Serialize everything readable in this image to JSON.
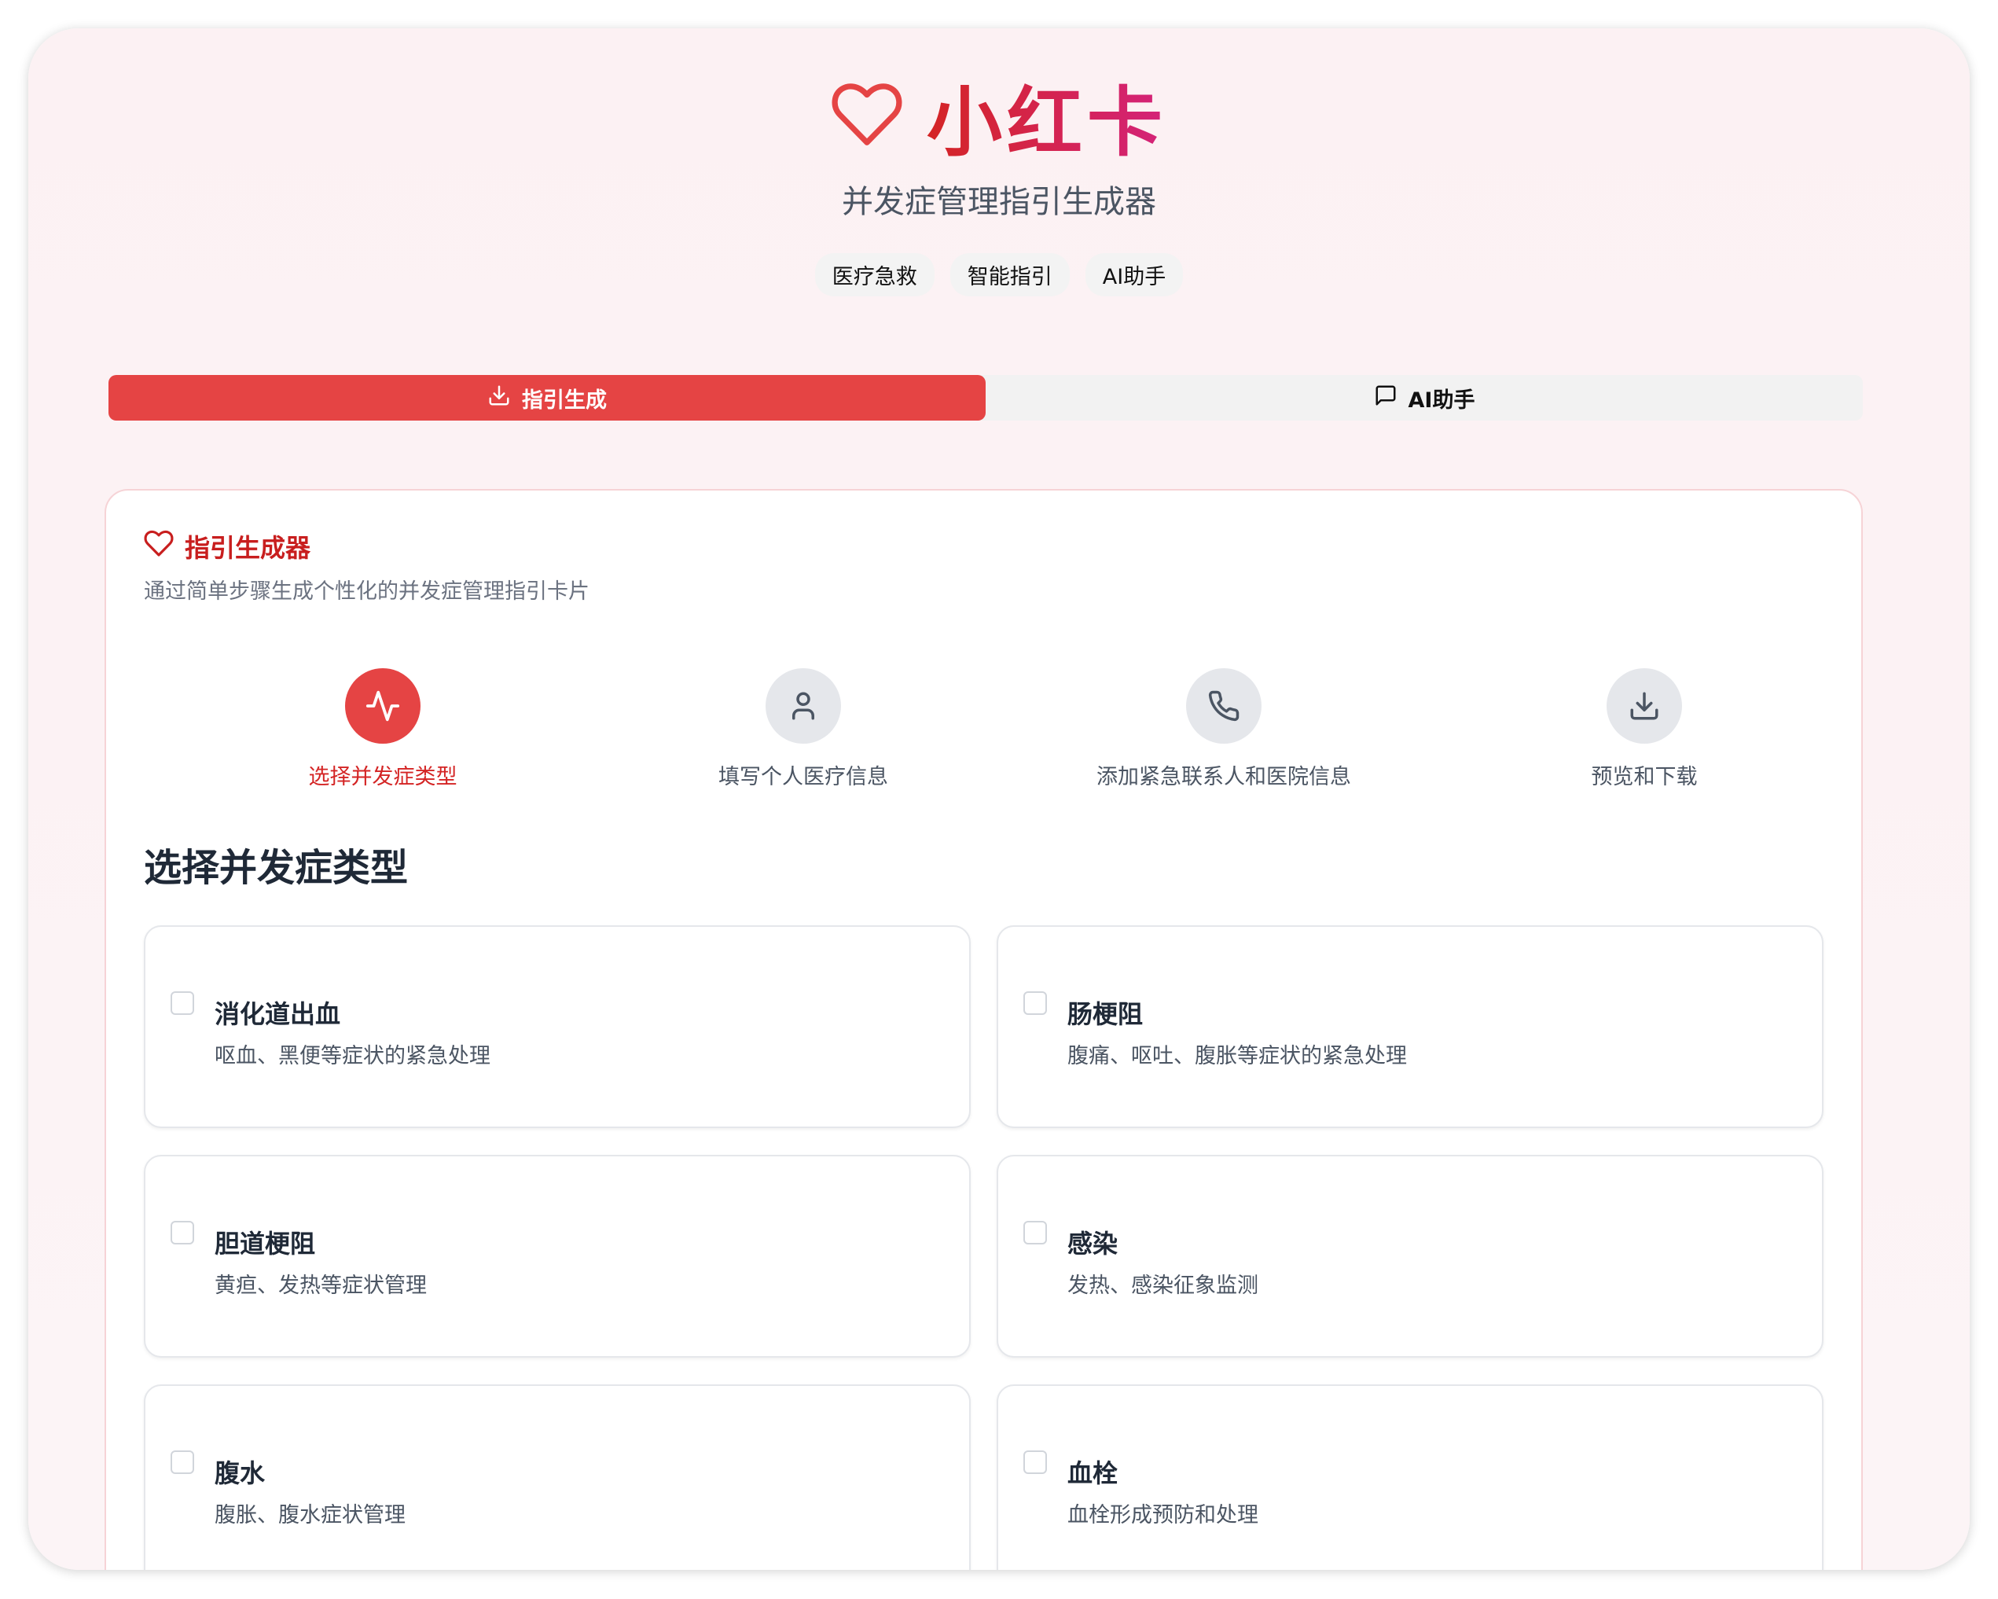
{
  "header": {
    "title": "小红卡",
    "subtitle": "并发症管理指引生成器",
    "badges": [
      "医疗急救",
      "智能指引",
      "AI助手"
    ]
  },
  "tabs": [
    {
      "label": "指引生成",
      "icon": "download-icon",
      "active": true
    },
    {
      "label": "AI助手",
      "icon": "message-icon",
      "active": false
    }
  ],
  "card": {
    "title": "指引生成器",
    "description": "通过简单步骤生成个性化的并发症管理指引卡片"
  },
  "steps": [
    {
      "label": "选择并发症类型",
      "icon": "activity-icon",
      "active": true
    },
    {
      "label": "填写个人医疗信息",
      "icon": "user-icon"
    },
    {
      "label": "添加紧急联系人和医院信息",
      "icon": "phone-icon"
    },
    {
      "label": "预览和下载",
      "icon": "download-icon"
    }
  ],
  "section_title": "选择并发症类型",
  "options": [
    {
      "title": "消化道出血",
      "desc": "呕血、黑便等症状的紧急处理",
      "checked": false
    },
    {
      "title": "肠梗阻",
      "desc": "腹痛、呕吐、腹胀等症状的紧急处理",
      "checked": false
    },
    {
      "title": "胆道梗阻",
      "desc": "黄疸、发热等症状管理",
      "checked": false
    },
    {
      "title": "感染",
      "desc": "发热、感染征象监测",
      "checked": false
    },
    {
      "title": "腹水",
      "desc": "腹胀、腹水症状管理",
      "checked": false
    },
    {
      "title": "血栓",
      "desc": "血栓形成预防和处理",
      "checked": false
    }
  ],
  "colors": {
    "accent": "#e54444",
    "title_red": "#c81e1e"
  }
}
